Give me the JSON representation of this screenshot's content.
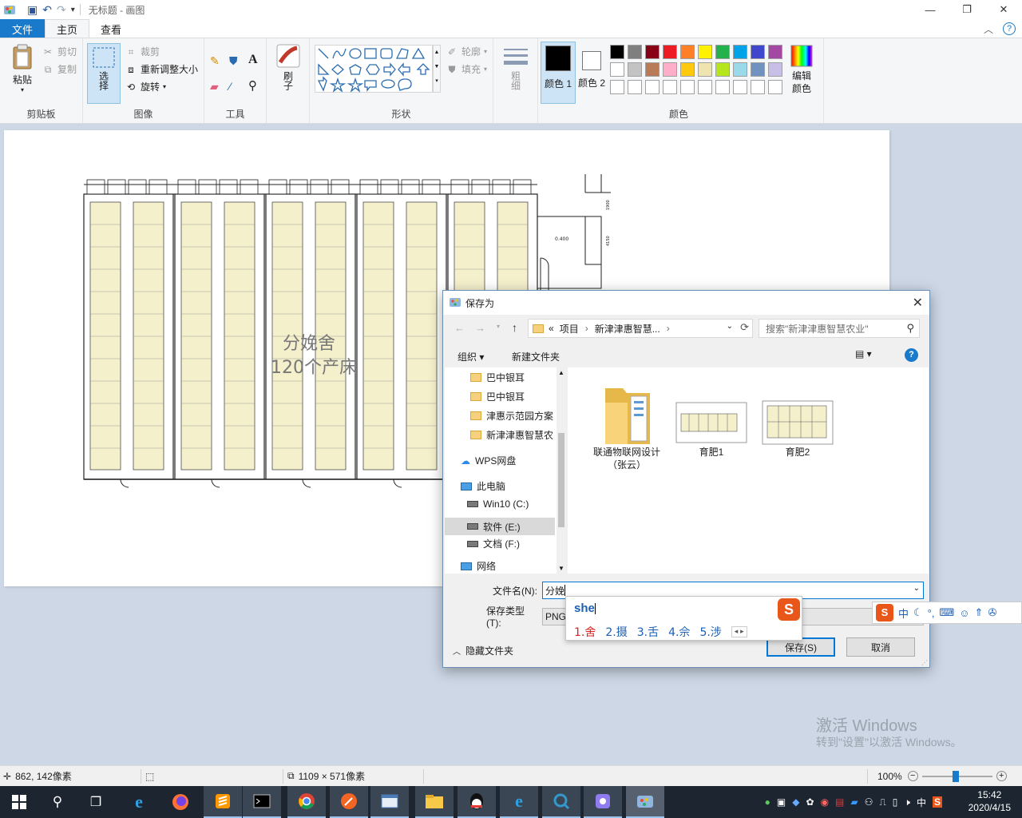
{
  "window": {
    "title": "无标题 - 画图",
    "controls": [
      "minimize",
      "maximize",
      "close"
    ]
  },
  "tabs": [
    {
      "label": "文件"
    },
    {
      "label": "主页"
    },
    {
      "label": "查看"
    }
  ],
  "ribbon": {
    "clipboard": {
      "label": "剪贴板",
      "paste": "粘贴",
      "cut": "剪切",
      "copy": "复制"
    },
    "image": {
      "label": "图像",
      "select": "选择",
      "crop": "裁剪",
      "resize": "重新调整大小",
      "rotate": "旋转"
    },
    "tools": {
      "label": "工具"
    },
    "brush": {
      "label": "刷子"
    },
    "shapes": {
      "label": "形状",
      "outline": "轮廓",
      "fill": "填充"
    },
    "size": {
      "label": "粗细"
    },
    "color1": {
      "label": "颜色 1"
    },
    "color2": {
      "label": "颜色 2"
    },
    "colors": {
      "label": "颜色",
      "edit": "编辑颜色"
    }
  },
  "palette": {
    "row1": [
      "#000000",
      "#7f7f7f",
      "#880015",
      "#ed1c24",
      "#ff7f27",
      "#fff200",
      "#22b14c",
      "#00a2e8",
      "#3f48cc",
      "#a349a4"
    ],
    "row2": [
      "#ffffff",
      "#c3c3c3",
      "#b97a57",
      "#ffaec9",
      "#ffc90e",
      "#efe4b0",
      "#b5e61d",
      "#99d9ea",
      "#7092be",
      "#c8bfe7"
    ],
    "row3": [
      "#ffffff",
      "#ffffff",
      "#ffffff",
      "#ffffff",
      "#ffffff",
      "#ffffff",
      "#ffffff",
      "#ffffff",
      "#ffffff",
      "#ffffff"
    ]
  },
  "canvas": {
    "drawing_text_1": "分娩舍",
    "drawing_text_2": "120个产床",
    "drawing_label_1": "0.400",
    "drawing_label_2": "1900",
    "drawing_label_3": "4150"
  },
  "statusbar": {
    "cursor_pos": "862, 142像素",
    "image_size": "1109 × 571像素",
    "zoom": "100%"
  },
  "watermark": {
    "line1": "激活 Windows",
    "line2": "转到\"设置\"以激活 Windows。"
  },
  "dialog": {
    "title": "保存为",
    "breadcrumb": [
      "«",
      "项目",
      "›",
      "新津津惠智慧...",
      "›"
    ],
    "search_placeholder": "搜索\"新津津惠智慧农业\"",
    "organize": "组织 ▾",
    "new_folder": "新建文件夹",
    "nav": [
      {
        "label": "巴中银耳",
        "kind": "folder"
      },
      {
        "label": "巴中银耳",
        "kind": "folder"
      },
      {
        "label": "津惠示范园方案",
        "kind": "folder"
      },
      {
        "label": "新津津惠智慧农",
        "kind": "folder"
      },
      {
        "label": "WPS网盘",
        "kind": "cloud"
      },
      {
        "label": "此电脑",
        "kind": "pc"
      },
      {
        "label": "Win10 (C:)",
        "kind": "drive"
      },
      {
        "label": "软件 (E:)",
        "kind": "drive"
      },
      {
        "label": "文档 (F:)",
        "kind": "drive"
      },
      {
        "label": "网络",
        "kind": "network"
      }
    ],
    "files": [
      {
        "label": "联通物联网设计（张云）",
        "kind": "folder"
      },
      {
        "label": "育肥1",
        "kind": "image"
      },
      {
        "label": "育肥2",
        "kind": "image"
      }
    ],
    "filename_label": "文件名(N):",
    "filename_value": "分娩",
    "filetype_label": "保存类型(T):",
    "filetype_value": "PNG",
    "hide_folders": "隐藏文件夹",
    "save": "保存(S)",
    "cancel": "取消"
  },
  "ime": {
    "pinyin": "she",
    "candidates": [
      "1.舍",
      "2.摄",
      "3.舌",
      "4.佘",
      "5.涉"
    ],
    "mode": "中"
  },
  "taskbar": {
    "ime_indicator": "中",
    "time": "15:42",
    "date": "2020/4/15"
  }
}
